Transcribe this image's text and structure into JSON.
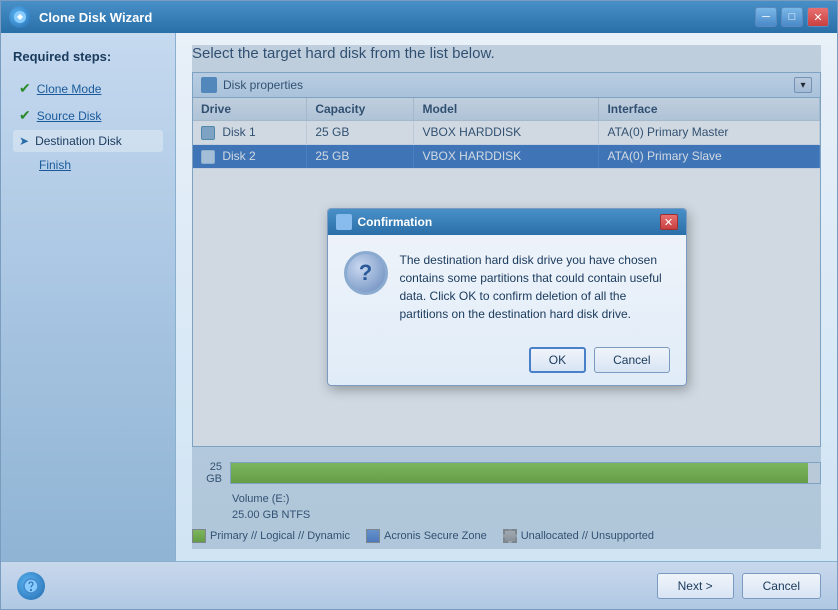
{
  "titleBar": {
    "title": "Clone Disk Wizard",
    "minimizeLabel": "─",
    "maximizeLabel": "□",
    "closeLabel": "✕"
  },
  "sidebar": {
    "title": "Required steps:",
    "items": [
      {
        "id": "clone-mode",
        "label": "Clone Mode",
        "status": "checked"
      },
      {
        "id": "source-disk",
        "label": "Source Disk",
        "status": "checked"
      },
      {
        "id": "destination-disk",
        "label": "Destination Disk",
        "status": "active"
      },
      {
        "id": "finish",
        "label": "Finish",
        "status": "none"
      }
    ]
  },
  "content": {
    "title": "Select the target hard disk from the list below.",
    "diskProperties": {
      "headerTitle": "Disk properties",
      "columns": [
        "Drive",
        "Capacity",
        "Model",
        "Interface"
      ],
      "rows": [
        {
          "drive": "Disk 1",
          "capacity": "25 GB",
          "model": "VBOX HARDDISK",
          "interface": "ATA(0) Primary Master",
          "selected": false
        },
        {
          "drive": "Disk 2",
          "capacity": "25 GB",
          "model": "VBOX HARDDISK",
          "interface": "ATA(0) Primary Slave",
          "selected": true
        }
      ]
    },
    "diskBar": {
      "sizeLabel": "25 GB",
      "fillPercent": 98,
      "volumeLabel": "Volume (E:)",
      "volumeSize": "25.00 GB  NTFS"
    },
    "legend": [
      {
        "id": "primary",
        "color": "green",
        "label": "Primary // Logical // Dynamic"
      },
      {
        "id": "secure-zone",
        "color": "blue",
        "label": "Acronis Secure Zone"
      },
      {
        "id": "unallocated",
        "color": "gray",
        "label": "Unallocated // Unsupported"
      }
    ]
  },
  "dialog": {
    "title": "Confirmation",
    "infoSymbol": "?",
    "message": "The destination hard disk drive you have chosen contains some partitions that could contain useful data. Click OK to confirm deletion of all the partitions on the destination hard disk drive.",
    "okLabel": "OK",
    "cancelLabel": "Cancel"
  },
  "footer": {
    "nextLabel": "Next >",
    "cancelLabel": "Cancel"
  }
}
